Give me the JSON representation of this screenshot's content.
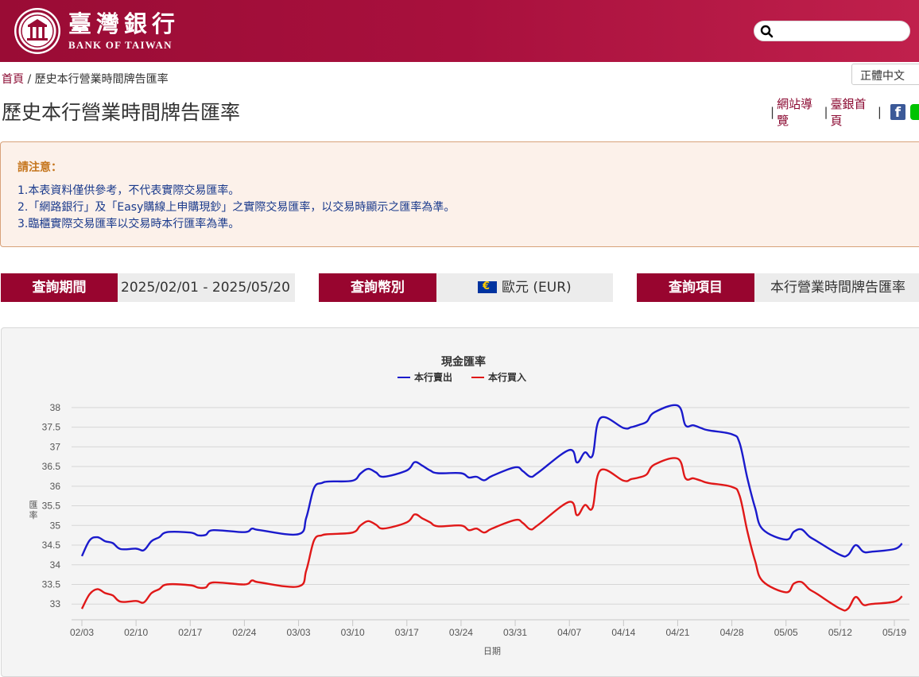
{
  "header": {
    "logo_cn": "臺灣銀行",
    "logo_en": "BANK OF TAIWAN",
    "search_placeholder": ""
  },
  "breadcrumb": {
    "home": "首頁",
    "separator": "/",
    "current": "歷史本行營業時間牌告匯率"
  },
  "lang": "正體中文",
  "page_title": "歷史本行營業時間牌告匯率",
  "top_links": {
    "sitemap": "網站導覽",
    "homepage": "臺銀首頁"
  },
  "notice": {
    "title": "請注意：",
    "items": [
      "1.本表資料僅供參考，不代表實際交易匯率。",
      "2.「網路銀行」及「Easy購線上申購現鈔」之實際交易匯率，以交易時顯示之匯率為準。",
      "3.臨櫃實際交易匯率以交易時本行匯率為準。"
    ]
  },
  "query": {
    "period_label": "查詢期間",
    "period_value": "2025/02/01 - 2025/05/20",
    "currency_label": "查詢幣別",
    "currency_value": "歐元 (EUR)",
    "item_label": "查詢項目",
    "item_value": "本行營業時間牌告匯率"
  },
  "colors": {
    "brand": "#98052f",
    "sell": "#1a1acc",
    "buy": "#e01818"
  },
  "chart_data": {
    "type": "line",
    "title": "現金匯率",
    "xlabel": "日期",
    "ylabel": "匯率",
    "ylim": [
      32.6,
      38.2
    ],
    "yticks": [
      33,
      33.5,
      34,
      34.5,
      35,
      35.5,
      36,
      36.5,
      37,
      37.5,
      38
    ],
    "xticks": [
      "02/03",
      "02/10",
      "02/17",
      "02/24",
      "03/03",
      "03/10",
      "03/17",
      "03/24",
      "03/31",
      "04/07",
      "04/14",
      "04/21",
      "04/28",
      "05/05",
      "05/12",
      "05/19"
    ],
    "legend_position": "top-center",
    "grid": true,
    "series": [
      {
        "name": "本行賣出",
        "color": "#1a1acc",
        "points": [
          [
            "02/03",
            34.22
          ],
          [
            "02/04",
            34.62
          ],
          [
            "02/05",
            34.7
          ],
          [
            "02/06",
            34.6
          ],
          [
            "02/07",
            34.55
          ],
          [
            "02/08",
            34.4
          ],
          [
            "02/10",
            34.41
          ],
          [
            "02/11",
            34.37
          ],
          [
            "02/12",
            34.6
          ],
          [
            "02/13",
            34.7
          ],
          [
            "02/14",
            34.83
          ],
          [
            "02/17",
            34.82
          ],
          [
            "02/18",
            34.75
          ],
          [
            "02/19",
            34.76
          ],
          [
            "02/20",
            34.88
          ],
          [
            "02/24",
            34.83
          ],
          [
            "02/25",
            34.92
          ],
          [
            "02/26",
            34.88
          ],
          [
            "03/03",
            34.78
          ],
          [
            "03/04",
            35.2
          ],
          [
            "03/05",
            35.95
          ],
          [
            "03/06",
            36.08
          ],
          [
            "03/07",
            36.12
          ],
          [
            "03/10",
            36.14
          ],
          [
            "03/11",
            36.32
          ],
          [
            "03/12",
            36.44
          ],
          [
            "03/13",
            36.35
          ],
          [
            "03/14",
            36.24
          ],
          [
            "03/17",
            36.4
          ],
          [
            "03/18",
            36.61
          ],
          [
            "03/19",
            36.52
          ],
          [
            "03/20",
            36.4
          ],
          [
            "03/21",
            36.33
          ],
          [
            "03/24",
            36.33
          ],
          [
            "03/25",
            36.22
          ],
          [
            "03/26",
            36.24
          ],
          [
            "03/27",
            36.15
          ],
          [
            "03/28",
            36.26
          ],
          [
            "03/31",
            36.48
          ],
          [
            "04/01",
            36.38
          ],
          [
            "04/02",
            36.24
          ],
          [
            "04/03",
            36.35
          ],
          [
            "04/07",
            36.92
          ],
          [
            "04/08",
            36.6
          ],
          [
            "04/09",
            36.86
          ],
          [
            "04/10",
            36.78
          ],
          [
            "04/11",
            37.73
          ],
          [
            "04/14",
            37.48
          ],
          [
            "04/15",
            37.5
          ],
          [
            "04/16",
            37.56
          ],
          [
            "04/17",
            37.64
          ],
          [
            "04/18",
            37.88
          ],
          [
            "04/21",
            38.05
          ],
          [
            "04/22",
            37.55
          ],
          [
            "04/23",
            37.55
          ],
          [
            "04/24",
            37.48
          ],
          [
            "04/25",
            37.42
          ],
          [
            "04/28",
            37.32
          ],
          [
            "04/29",
            37.1
          ],
          [
            "04/30",
            36.2
          ],
          [
            "05/01",
            35.45
          ],
          [
            "05/02",
            34.9
          ],
          [
            "05/05",
            34.64
          ],
          [
            "05/06",
            34.84
          ],
          [
            "05/07",
            34.9
          ],
          [
            "05/08",
            34.72
          ],
          [
            "05/09",
            34.6
          ],
          [
            "05/12",
            34.25
          ],
          [
            "05/13",
            34.25
          ],
          [
            "05/14",
            34.5
          ],
          [
            "05/15",
            34.33
          ],
          [
            "05/16",
            34.33
          ],
          [
            "05/19",
            34.4
          ],
          [
            "05/20",
            34.54
          ]
        ]
      },
      {
        "name": "本行買入",
        "color": "#e01818",
        "points": [
          [
            "02/03",
            32.88
          ],
          [
            "02/04",
            33.25
          ],
          [
            "02/05",
            33.38
          ],
          [
            "02/06",
            33.28
          ],
          [
            "02/07",
            33.22
          ],
          [
            "02/08",
            33.06
          ],
          [
            "02/10",
            33.08
          ],
          [
            "02/11",
            33.04
          ],
          [
            "02/12",
            33.28
          ],
          [
            "02/13",
            33.38
          ],
          [
            "02/14",
            33.5
          ],
          [
            "02/17",
            33.48
          ],
          [
            "02/18",
            33.42
          ],
          [
            "02/19",
            33.42
          ],
          [
            "02/20",
            33.55
          ],
          [
            "02/24",
            33.5
          ],
          [
            "02/25",
            33.6
          ],
          [
            "02/26",
            33.55
          ],
          [
            "03/03",
            33.45
          ],
          [
            "03/04",
            33.86
          ],
          [
            "03/05",
            34.62
          ],
          [
            "03/06",
            34.75
          ],
          [
            "03/07",
            34.78
          ],
          [
            "03/10",
            34.82
          ],
          [
            "03/11",
            35.0
          ],
          [
            "03/12",
            35.11
          ],
          [
            "03/13",
            35.02
          ],
          [
            "03/14",
            34.92
          ],
          [
            "03/17",
            35.08
          ],
          [
            "03/18",
            35.28
          ],
          [
            "03/19",
            35.18
          ],
          [
            "03/20",
            35.08
          ],
          [
            "03/21",
            34.98
          ],
          [
            "03/24",
            35.0
          ],
          [
            "03/25",
            34.88
          ],
          [
            "03/26",
            34.92
          ],
          [
            "03/27",
            34.82
          ],
          [
            "03/28",
            34.92
          ],
          [
            "03/31",
            35.14
          ],
          [
            "04/01",
            35.06
          ],
          [
            "04/02",
            34.9
          ],
          [
            "04/03",
            35.02
          ],
          [
            "04/07",
            35.6
          ],
          [
            "04/08",
            35.26
          ],
          [
            "04/09",
            35.52
          ],
          [
            "04/10",
            35.45
          ],
          [
            "04/11",
            36.4
          ],
          [
            "04/14",
            36.14
          ],
          [
            "04/15",
            36.18
          ],
          [
            "04/16",
            36.22
          ],
          [
            "04/17",
            36.3
          ],
          [
            "04/18",
            36.55
          ],
          [
            "04/21",
            36.7
          ],
          [
            "04/22",
            36.2
          ],
          [
            "04/23",
            36.2
          ],
          [
            "04/24",
            36.14
          ],
          [
            "04/25",
            36.08
          ],
          [
            "04/28",
            35.98
          ],
          [
            "04/29",
            35.76
          ],
          [
            "04/30",
            34.85
          ],
          [
            "05/01",
            34.1
          ],
          [
            "05/02",
            33.58
          ],
          [
            "05/05",
            33.3
          ],
          [
            "05/06",
            33.52
          ],
          [
            "05/07",
            33.56
          ],
          [
            "05/08",
            33.38
          ],
          [
            "05/09",
            33.26
          ],
          [
            "05/12",
            32.88
          ],
          [
            "05/13",
            32.88
          ],
          [
            "05/14",
            33.18
          ],
          [
            "05/15",
            32.98
          ],
          [
            "05/16",
            33.0
          ],
          [
            "05/19",
            33.06
          ],
          [
            "05/20",
            33.2
          ]
        ]
      }
    ]
  }
}
